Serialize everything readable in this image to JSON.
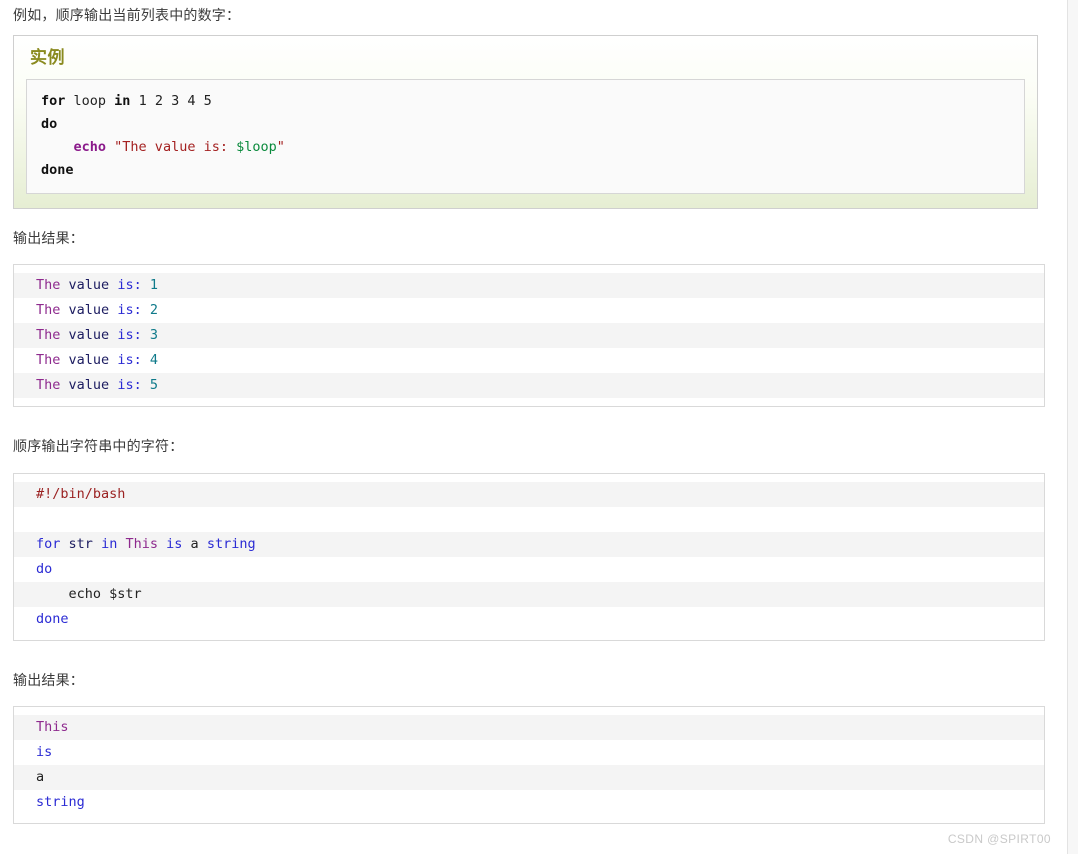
{
  "intro_text": "例如，顺序输出当前列表中的数字：",
  "example_box": {
    "title": "实例",
    "code_lines": [
      [
        {
          "t": "for",
          "c": "k-bold"
        },
        {
          "t": " loop ",
          "c": "k-plain"
        },
        {
          "t": "in",
          "c": "k-bold"
        },
        {
          "t": " 1 2 3 4 5",
          "c": "k-plain"
        }
      ],
      [
        {
          "t": "do",
          "c": "k-bold"
        }
      ],
      [
        {
          "t": "    ",
          "c": "k-plain"
        },
        {
          "t": "echo",
          "c": "k-echo"
        },
        {
          "t": " ",
          "c": "k-plain"
        },
        {
          "t": "\"The value is: ",
          "c": "k-str"
        },
        {
          "t": "$loop",
          "c": "k-var"
        },
        {
          "t": "\"",
          "c": "k-str"
        }
      ],
      [
        {
          "t": "done",
          "c": "k-bold"
        }
      ]
    ]
  },
  "label_output_1": "输出结果：",
  "output_block_1": [
    [
      {
        "t": "The",
        "c": "t-purple"
      },
      {
        "t": " ",
        "c": "t-dark"
      },
      {
        "t": "value",
        "c": "t-navy"
      },
      {
        "t": " ",
        "c": "t-dark"
      },
      {
        "t": "is:",
        "c": "t-blue"
      },
      {
        "t": " ",
        "c": "t-dark"
      },
      {
        "t": "1",
        "c": "t-teal"
      }
    ],
    [
      {
        "t": "The",
        "c": "t-purple"
      },
      {
        "t": " ",
        "c": "t-dark"
      },
      {
        "t": "value",
        "c": "t-navy"
      },
      {
        "t": " ",
        "c": "t-dark"
      },
      {
        "t": "is:",
        "c": "t-blue"
      },
      {
        "t": " ",
        "c": "t-dark"
      },
      {
        "t": "2",
        "c": "t-teal"
      }
    ],
    [
      {
        "t": "The",
        "c": "t-purple"
      },
      {
        "t": " ",
        "c": "t-dark"
      },
      {
        "t": "value",
        "c": "t-navy"
      },
      {
        "t": " ",
        "c": "t-dark"
      },
      {
        "t": "is:",
        "c": "t-blue"
      },
      {
        "t": " ",
        "c": "t-dark"
      },
      {
        "t": "3",
        "c": "t-teal"
      }
    ],
    [
      {
        "t": "The",
        "c": "t-purple"
      },
      {
        "t": " ",
        "c": "t-dark"
      },
      {
        "t": "value",
        "c": "t-navy"
      },
      {
        "t": " ",
        "c": "t-dark"
      },
      {
        "t": "is:",
        "c": "t-blue"
      },
      {
        "t": " ",
        "c": "t-dark"
      },
      {
        "t": "4",
        "c": "t-teal"
      }
    ],
    [
      {
        "t": "The",
        "c": "t-purple"
      },
      {
        "t": " ",
        "c": "t-dark"
      },
      {
        "t": "value",
        "c": "t-navy"
      },
      {
        "t": " ",
        "c": "t-dark"
      },
      {
        "t": "is:",
        "c": "t-blue"
      },
      {
        "t": " ",
        "c": "t-dark"
      },
      {
        "t": "5",
        "c": "t-teal"
      }
    ]
  ],
  "label_string_loop": "顺序输出字符串中的字符：",
  "script_block": [
    [
      {
        "t": "#!/bin/bash",
        "c": "t-red"
      }
    ],
    [
      {
        "t": "",
        "c": "t-dark"
      }
    ],
    [
      {
        "t": "for",
        "c": "t-blue"
      },
      {
        "t": " ",
        "c": "t-dark"
      },
      {
        "t": "str",
        "c": "t-navy"
      },
      {
        "t": " ",
        "c": "t-dark"
      },
      {
        "t": "in",
        "c": "t-blue"
      },
      {
        "t": " ",
        "c": "t-dark"
      },
      {
        "t": "This",
        "c": "t-purple"
      },
      {
        "t": " ",
        "c": "t-dark"
      },
      {
        "t": "is",
        "c": "t-blue"
      },
      {
        "t": " ",
        "c": "t-dark"
      },
      {
        "t": "a",
        "c": "t-dark"
      },
      {
        "t": " ",
        "c": "t-dark"
      },
      {
        "t": "string",
        "c": "t-blue"
      }
    ],
    [
      {
        "t": "do",
        "c": "t-blue"
      }
    ],
    [
      {
        "t": "    ",
        "c": "t-dark"
      },
      {
        "t": "echo $str",
        "c": "t-dark"
      }
    ],
    [
      {
        "t": "done",
        "c": "t-blue"
      }
    ]
  ],
  "label_output_2": "输出结果：",
  "output_block_2": [
    [
      {
        "t": "This",
        "c": "t-purple"
      }
    ],
    [
      {
        "t": "is",
        "c": "t-blue"
      }
    ],
    [
      {
        "t": "a",
        "c": "t-dark"
      }
    ],
    [
      {
        "t": "string",
        "c": "t-blue"
      }
    ]
  ],
  "watermark": "CSDN @SPIRT00"
}
